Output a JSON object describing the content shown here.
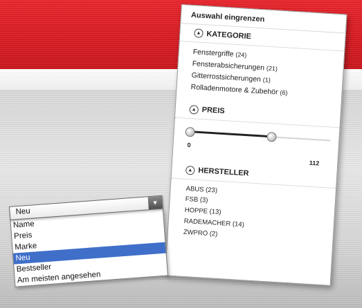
{
  "colors": {
    "brand_red": "#d71920",
    "selected_blue": "#3f6fc9"
  },
  "filter": {
    "title": "Auswahl eingrenzen",
    "sections": {
      "kategorie": {
        "label": "KATEGORIE",
        "icon": "chevron-up-circle-icon",
        "items": [
          {
            "label": "Fenstergriffe",
            "count": "(24)"
          },
          {
            "label": "Fensterabsicherungen",
            "count": "(21)"
          },
          {
            "label": "Gitterrostsicherungen",
            "count": "(1)"
          },
          {
            "label": "Rolladenmotore & Zubehör",
            "count": "(6)"
          }
        ]
      },
      "preis": {
        "label": "PREIS",
        "icon": "chevron-up-circle-icon",
        "min": "0",
        "max": "112",
        "range_fraction": [
          0.0,
          0.58
        ]
      },
      "hersteller": {
        "label": "HERSTELLER",
        "icon": "chevron-up-circle-icon",
        "items": [
          {
            "label": "ABUS (23)"
          },
          {
            "label": "FSB (3)"
          },
          {
            "label": "HOPPE (13)"
          },
          {
            "label": "RADEMACHER (14)"
          },
          {
            "label": "ZWPRO (2)"
          }
        ]
      }
    }
  },
  "sort": {
    "selected": "Neu",
    "arrow_icon": "dropdown-arrow-icon",
    "options": [
      "Name",
      "Preis",
      "Marke",
      "Neu",
      "Bestseller",
      "Am meisten angesehen"
    ],
    "highlighted_index": 3
  }
}
